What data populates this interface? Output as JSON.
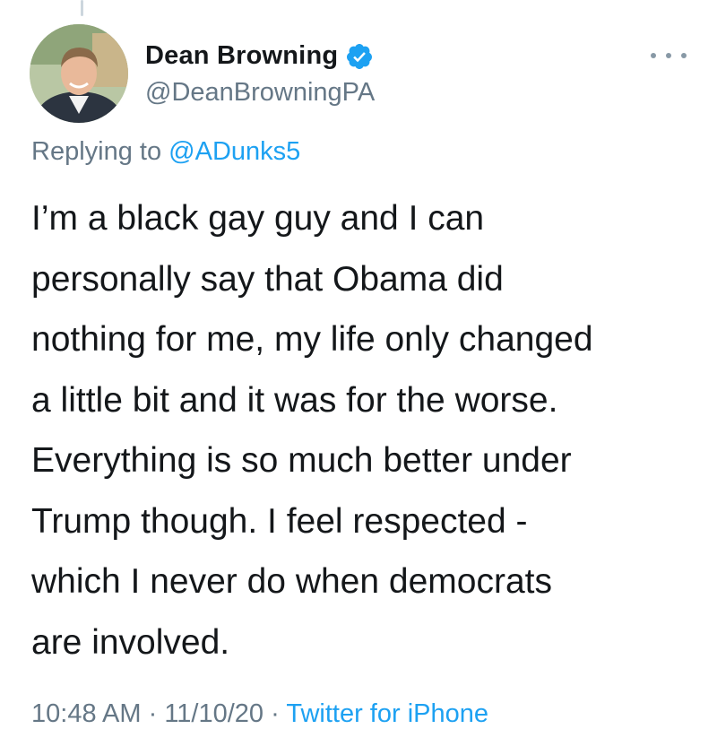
{
  "tweet": {
    "author": {
      "display_name": "Dean Browning",
      "handle": "@DeanBrowningPA",
      "verified": true,
      "avatar_icon": "profile-photo"
    },
    "more_icon": "more-options-icon",
    "reply": {
      "prefix": "Replying to",
      "mention": "@ADunks5"
    },
    "body_lines": [
      "I’m a black gay guy and I can",
      "personally say that Obama did",
      "nothing for me, my life only changed",
      "a little bit and it was for the worse.",
      "Everything is so much better under",
      "Trump though. I feel respected -",
      "which I never do when democrats",
      "are involved."
    ],
    "meta": {
      "time": "10:48 AM",
      "date": "11/10/20",
      "separator": "·",
      "source": "Twitter for iPhone"
    }
  },
  "colors": {
    "text": "#14171a",
    "secondary": "#657786",
    "accent": "#1da1f2"
  }
}
